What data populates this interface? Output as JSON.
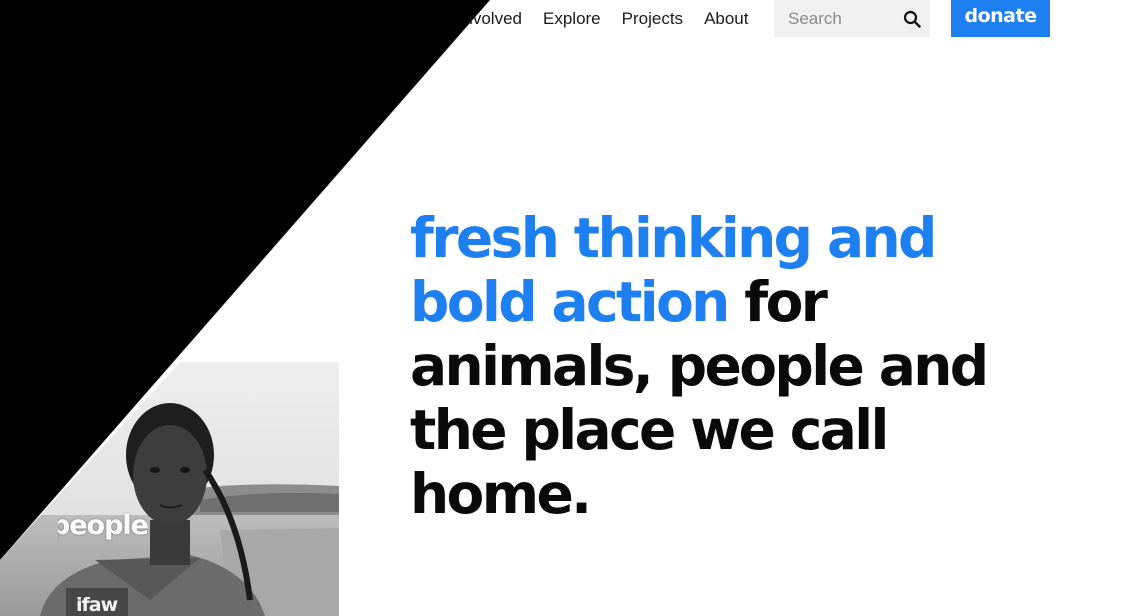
{
  "nav": {
    "items": [
      {
        "label": "Get Involved"
      },
      {
        "label": "Explore"
      },
      {
        "label": "Projects"
      },
      {
        "label": "About"
      }
    ],
    "search_placeholder": "Search",
    "donate_label": "donate"
  },
  "hero": {
    "highlight_line1": "fresh thinking and",
    "highlight_line2": "bold action",
    "rest_line2": " for",
    "line3": "animals, people and",
    "line4": "the place we call",
    "line5": "home."
  },
  "photo": {
    "caption": "people",
    "badge_text": "ifaw"
  },
  "colors": {
    "accent": "#1d7ff0",
    "text": "#0a0a0a",
    "wedge": "#000000"
  },
  "icons": {
    "search": "search-icon"
  }
}
